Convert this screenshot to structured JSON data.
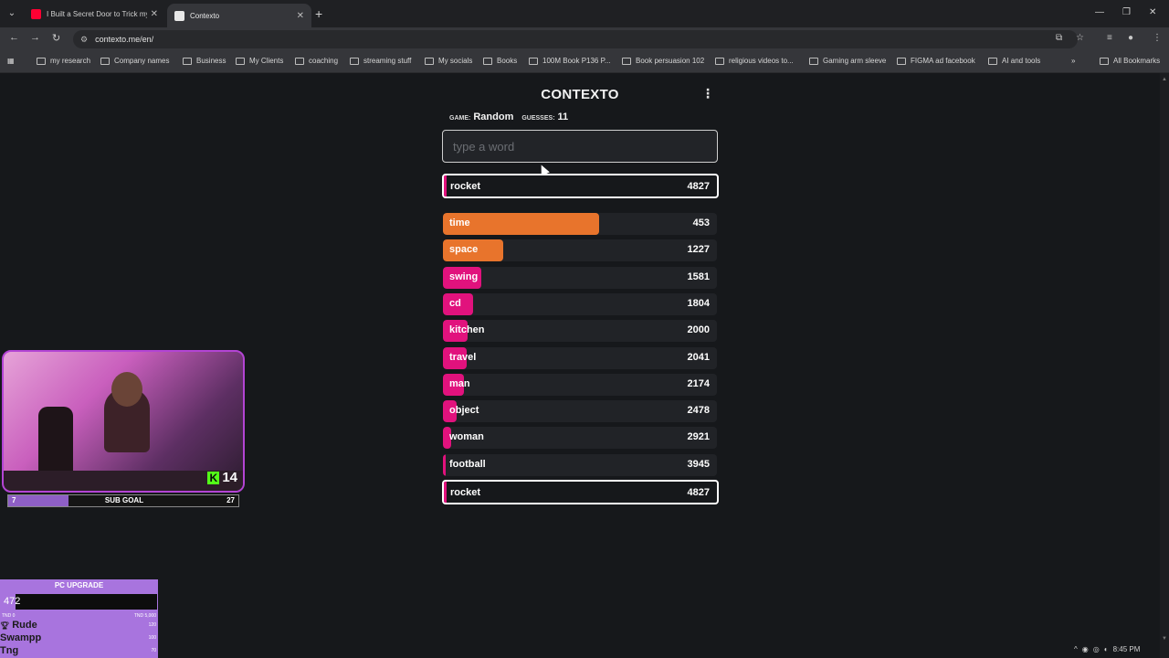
{
  "browser": {
    "tabs": [
      {
        "title": "I Built a Secret Door to Trick my",
        "active": false,
        "favicon_color": "#ff0033"
      },
      {
        "title": "Contexto",
        "active": true,
        "favicon_color": "#e8e8e8"
      }
    ],
    "url": "contexto.me/en/",
    "bookmarks": [
      "my research",
      "Company names",
      "Business",
      "My Clients",
      "coaching",
      "streaming stuff",
      "My socials",
      "Books",
      "100M Book P136 P...",
      "Book persuasion 102",
      "religious videos to...",
      "Gaming arm sleeve",
      "FIGMA ad facebook",
      "AI and tools"
    ],
    "all_bookmarks": "All Bookmarks"
  },
  "game": {
    "title": "CONTEXTO",
    "game_label": "GAME:",
    "game_value": "Random",
    "guesses_label": "GUESSES:",
    "guesses_value": "11",
    "input_placeholder": "type a word",
    "last_guess": {
      "word": "rocket",
      "rank": "4827"
    },
    "guesses": [
      {
        "word": "time",
        "rank": "453",
        "fill": 0.57,
        "color": "#e8742c"
      },
      {
        "word": "space",
        "rank": "1227",
        "fill": 0.22,
        "color": "#e8742c"
      },
      {
        "word": "swing",
        "rank": "1581",
        "fill": 0.14,
        "color": "#e1127d"
      },
      {
        "word": "cd",
        "rank": "1804",
        "fill": 0.11,
        "color": "#e1127d"
      },
      {
        "word": "kitchen",
        "rank": "2000",
        "fill": 0.09,
        "color": "#e1127d"
      },
      {
        "word": "travel",
        "rank": "2041",
        "fill": 0.085,
        "color": "#e1127d"
      },
      {
        "word": "man",
        "rank": "2174",
        "fill": 0.075,
        "color": "#e1127d"
      },
      {
        "word": "object",
        "rank": "2478",
        "fill": 0.05,
        "color": "#e1127d"
      },
      {
        "word": "woman",
        "rank": "2921",
        "fill": 0.03,
        "color": "#e1127d"
      },
      {
        "word": "football",
        "rank": "3945",
        "fill": 0.01,
        "color": "#e1127d"
      },
      {
        "word": "rocket",
        "rank": "4827",
        "fill": 0.01,
        "color": "#e1127d",
        "highlight": true
      }
    ]
  },
  "overlay": {
    "kick_count": "14",
    "sub_goal": {
      "label": "SUB GOAL",
      "current": "7",
      "target": "27",
      "progress": 0.26
    },
    "pc_upgrade": {
      "label": "PC UPGRADE",
      "amount": "472",
      "min": "TND 0",
      "max": "TND 5,000",
      "progress": 0.094,
      "donors": [
        {
          "name": "Rude",
          "amount": "120"
        },
        {
          "name": "Swampp",
          "amount": "100"
        },
        {
          "name": "Tng",
          "amount": "70"
        }
      ]
    }
  },
  "tray": {
    "time": "8:45 PM"
  }
}
